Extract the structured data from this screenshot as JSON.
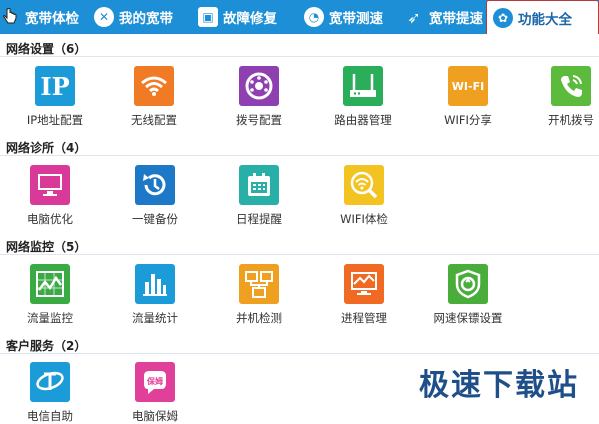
{
  "tabs": [
    {
      "label": "宽带体检",
      "icon": "checkup-icon"
    },
    {
      "label": "我的宽带",
      "icon": "broadband-icon"
    },
    {
      "label": "故障修复",
      "icon": "toolbox-icon"
    },
    {
      "label": "宽带测速",
      "icon": "speedometer-icon"
    },
    {
      "label": "宽带提速",
      "icon": "rocket-icon"
    },
    {
      "label": "功能大全",
      "icon": "feature-icon",
      "active": true
    }
  ],
  "sections": [
    {
      "title": "网络设置（6）",
      "items": [
        {
          "label": "IP地址配置",
          "icon": "ip-icon",
          "color": "#1b9bd8"
        },
        {
          "label": "无线配置",
          "icon": "wifi-icon",
          "color": "#f07b24"
        },
        {
          "label": "拨号配置",
          "icon": "dial-icon",
          "color": "#8e3fb0"
        },
        {
          "label": "路由器管理",
          "icon": "router-icon",
          "color": "#2aae5a"
        },
        {
          "label": "WIFI分享",
          "icon": "wifi-share-icon",
          "color": "#f0a020"
        },
        {
          "label": "开机拨号",
          "icon": "phone-icon",
          "color": "#5cba3c"
        }
      ]
    },
    {
      "title": "网络诊所（4）",
      "items": [
        {
          "label": "电脑优化",
          "icon": "monitor-icon",
          "color": "#d93a9a"
        },
        {
          "label": "一键备份",
          "icon": "backup-icon",
          "color": "#1e78c8"
        },
        {
          "label": "日程提醒",
          "icon": "calendar-icon",
          "color": "#28b0a8"
        },
        {
          "label": "WIFI体检",
          "icon": "wifi-check-icon",
          "color": "#f3c321"
        }
      ]
    },
    {
      "title": "网络监控（5）",
      "items": [
        {
          "label": "流量监控",
          "icon": "traffic-monitor-icon",
          "color": "#3aaa44"
        },
        {
          "label": "流量统计",
          "icon": "bar-chart-icon",
          "color": "#1b9bd8"
        },
        {
          "label": "并机检测",
          "icon": "network-check-icon",
          "color": "#f0a020"
        },
        {
          "label": "进程管理",
          "icon": "process-icon",
          "color": "#f06a24"
        },
        {
          "label": "网速保镖设置",
          "icon": "shield-icon",
          "color": "#48ad3a"
        }
      ]
    },
    {
      "title": "客户服务（2）",
      "items": [
        {
          "label": "电信自助",
          "icon": "telecom-icon",
          "color": "#1b9bd8"
        },
        {
          "label": "电脑保姆",
          "icon": "nanny-icon",
          "color": "#e0409a"
        }
      ]
    }
  ],
  "watermark": "极速下载站"
}
